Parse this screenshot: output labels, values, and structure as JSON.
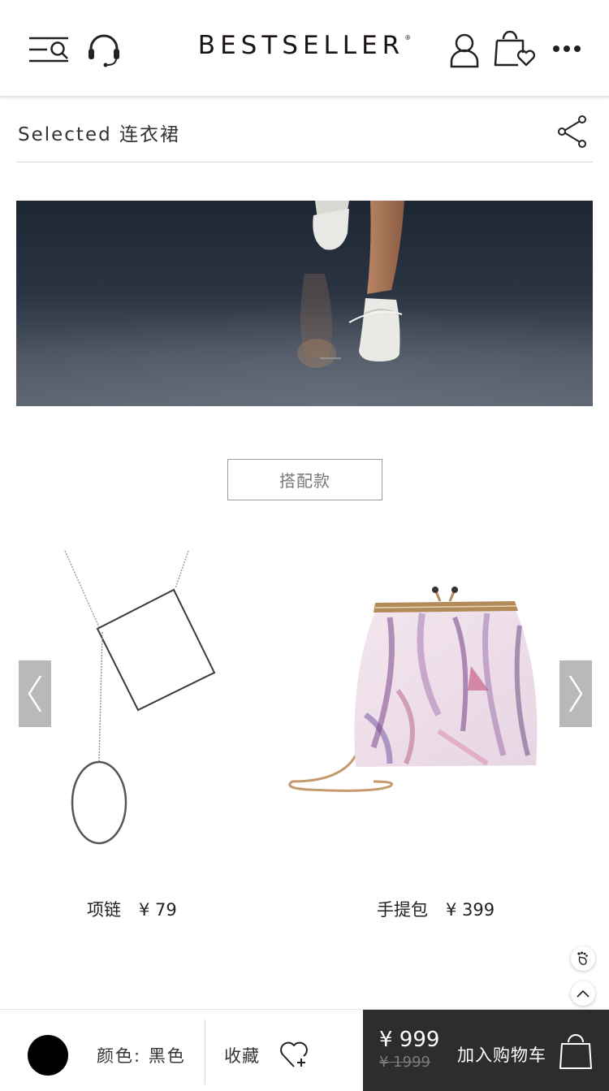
{
  "header": {
    "brand": "BESTSELLER",
    "brand_mark": "®",
    "icons": {
      "menu_search": "menu-search-icon",
      "support": "headset-icon",
      "account": "user-icon",
      "wishlist_bag": "bag-heart-icon",
      "more": "more-icon"
    }
  },
  "selected": {
    "text": "Selected 连衣裙",
    "share_icon": "share-icon"
  },
  "match_button": {
    "label": "搭配款"
  },
  "products": [
    {
      "name": "项链",
      "price": "¥ 79"
    },
    {
      "name": "手提包",
      "price": "¥ 399"
    }
  ],
  "bottom_bar": {
    "color_label": "颜色: 黑色",
    "swatch_color": "#000000",
    "favorite_label": "收藏",
    "price_now": "¥ 999",
    "price_old": "¥ 1999",
    "add_to_cart": "加入购物车"
  },
  "colors": {
    "cart_bg": "#2d2d2d",
    "arrow_bg": "#b9b9b9"
  }
}
